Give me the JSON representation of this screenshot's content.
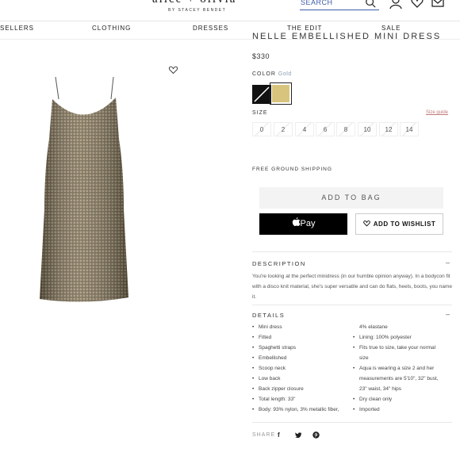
{
  "header": {
    "logo": "alice + olivia",
    "logo_sub": "BY STACEY BENDET",
    "search_placeholder": "SEARCH"
  },
  "nav": {
    "items": [
      "SELLERS",
      "CLOTHING",
      "DRESSES",
      "THE EDIT",
      "SALE"
    ]
  },
  "product": {
    "title": "NELLE EMBELLISHED MINI DRESS",
    "price": "$330",
    "color_label": "COLOR",
    "color_selected": "Gold",
    "swatch_colors": [
      "#111111",
      "#d9c47e"
    ],
    "size_label": "SIZE",
    "size_guide": "Size guide",
    "sizes": [
      "0",
      "2",
      "4",
      "6",
      "8",
      "10",
      "12",
      "14"
    ],
    "shipping": "FREE GROUND SHIPPING",
    "add_to_bag": "ADD TO BAG",
    "pay_label": "Pay",
    "wishlist_label": "ADD TO WISHLIST"
  },
  "description": {
    "heading": "DESCRIPTION",
    "toggle": "–",
    "text": "You're looking at the perfect minidress (in our humble opinion anyway). In a bodycon fit with a disco knit material, she's super versatile and can do flats, heels, boots, you name it."
  },
  "details": {
    "heading": "DETAILS",
    "toggle": "–",
    "left": [
      "Mini dress",
      "Fitted",
      "Spaghetti straps",
      "Embellished",
      "Scoop neck",
      "Low back",
      "Back zipper closure",
      "Total length: 33\"",
      "Body: 93% nylon, 3% metallic fiber,"
    ],
    "right": [
      {
        "text": "4% elastane",
        "bullet": false
      },
      {
        "text": "Lining: 100% polyester",
        "bullet": true
      },
      {
        "text": "Fits true to size, take your normal",
        "bullet": true
      },
      {
        "text": "size",
        "bullet": false
      },
      {
        "text": "Aqua is wearing a size 2 and her",
        "bullet": true
      },
      {
        "text": "measurements are 5'10\", 32\" bust,",
        "bullet": false
      },
      {
        "text": "23\" waist, 34\" hips",
        "bullet": false
      },
      {
        "text": "Dry clean only",
        "bullet": true
      },
      {
        "text": "Imported",
        "bullet": true
      }
    ]
  },
  "share": {
    "label": "SHARE",
    "icons": [
      "facebook-icon",
      "twitter-icon",
      "pinterest-icon"
    ]
  }
}
